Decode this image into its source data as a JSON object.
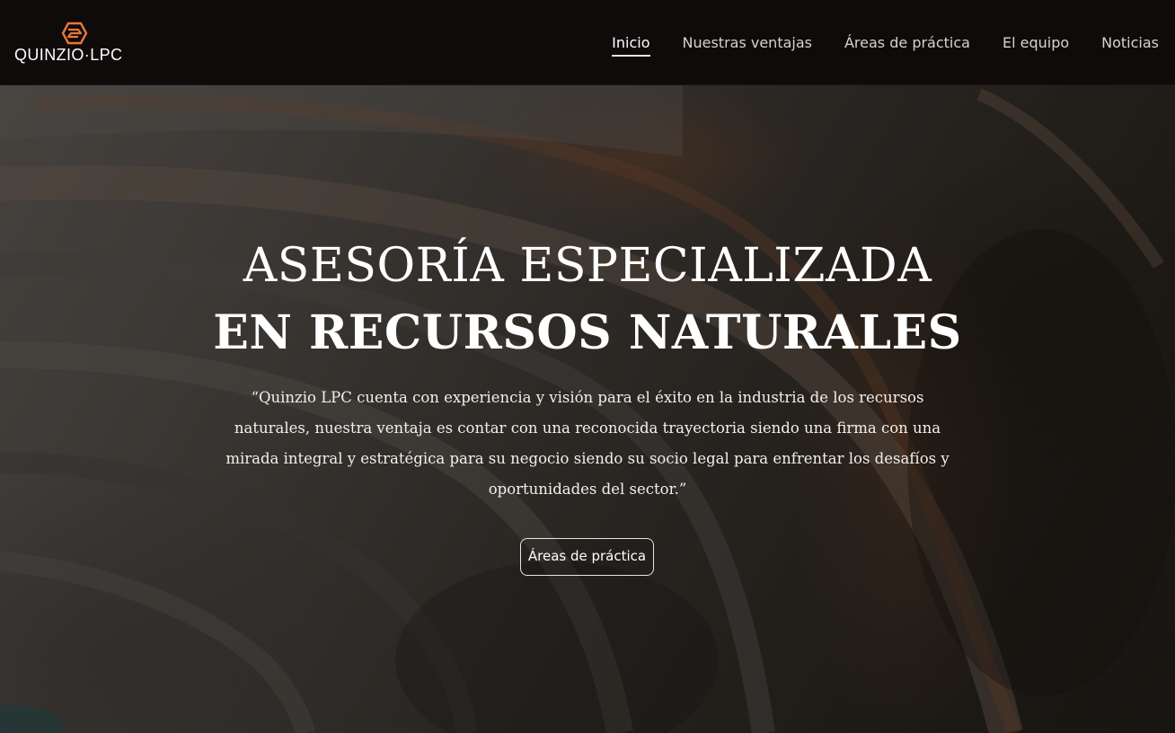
{
  "brand": {
    "name": "QUINZIO·LPC",
    "logo_icon": "hexagon-logo-icon",
    "accent_color": "#e8783a"
  },
  "nav": {
    "items": [
      {
        "label": "Inicio",
        "active": true
      },
      {
        "label": "Nuestras ventajas",
        "active": false
      },
      {
        "label": "Áreas de práctica",
        "active": false
      },
      {
        "label": "El equipo",
        "active": false
      },
      {
        "label": "Noticias",
        "active": false
      }
    ]
  },
  "hero": {
    "title_line1": "ASESORÍA ESPECIALIZADA",
    "title_line2": "EN RECURSOS NATURALES",
    "quote": "“Quinzio LPC cuenta con experiencia y visión para el éxito en la industria de los recursos naturales, nuestra ventaja es contar con una reconocida trayectoria siendo una firma con una mirada integral y estratégica para su negocio siendo su socio legal para enfrentar los desafíos y oportunidades del sector.”",
    "button_label": "Áreas de práctica",
    "background": "aerial-mine-photo"
  }
}
